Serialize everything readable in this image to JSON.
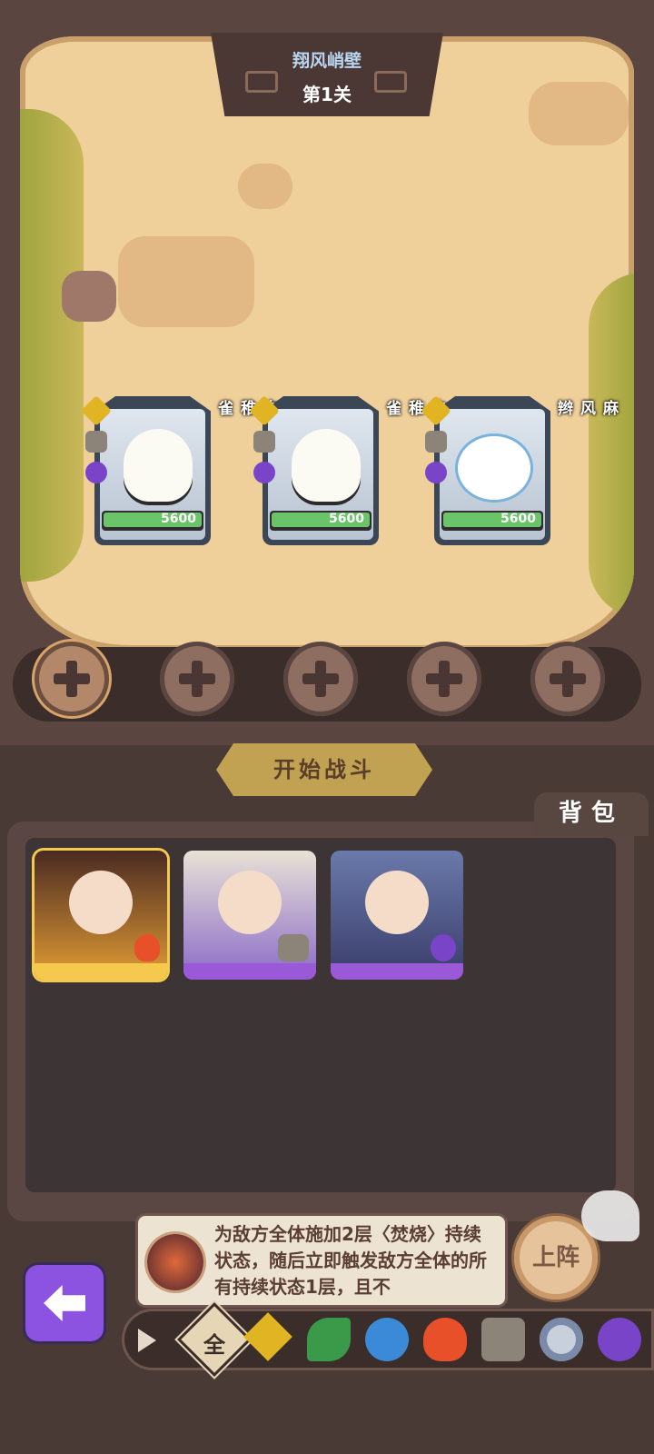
{
  "stage": {
    "name": "翔风峭壁",
    "level": "第1关"
  },
  "enemies": [
    {
      "name": "白稚雀",
      "hp": "5600",
      "hp_fraction": 1.0,
      "elements": [
        "earth-icon",
        "rock-icon",
        "thunder-icon"
      ]
    },
    {
      "name": "白稚雀",
      "hp": "5600",
      "hp_fraction": 1.0,
      "elements": [
        "earth-icon",
        "rock-icon",
        "thunder-icon"
      ]
    },
    {
      "name": "麻风辫",
      "hp": "5600",
      "hp_fraction": 1.0,
      "elements": [
        "earth-icon",
        "rock-icon",
        "thunder-icon"
      ]
    }
  ],
  "slots": {
    "count": 5,
    "selected_index": 0
  },
  "start_button": "开始战斗",
  "bag": {
    "title": "背包",
    "heroes": [
      {
        "rarity": "gold",
        "element": "fire-icon"
      },
      {
        "rarity": "purple",
        "element": "rock-icon"
      },
      {
        "rarity": "purple",
        "element": "thunder-icon"
      }
    ]
  },
  "skill": {
    "description": "为敌方全体施加2层〈焚烧〉持续状态，随后立即触发敌方全体的所有持续状态1层，且不"
  },
  "deploy_button": "上阵",
  "filter": {
    "all_label": "全",
    "elements": [
      "earth-icon",
      "wind-icon",
      "water-icon",
      "fire-icon",
      "rock-icon",
      "vortex-icon",
      "thunder-icon"
    ]
  },
  "colors": {
    "gold": "#f4c94e",
    "purple": "#8c52e0",
    "hp_green": "#6bc36a"
  }
}
